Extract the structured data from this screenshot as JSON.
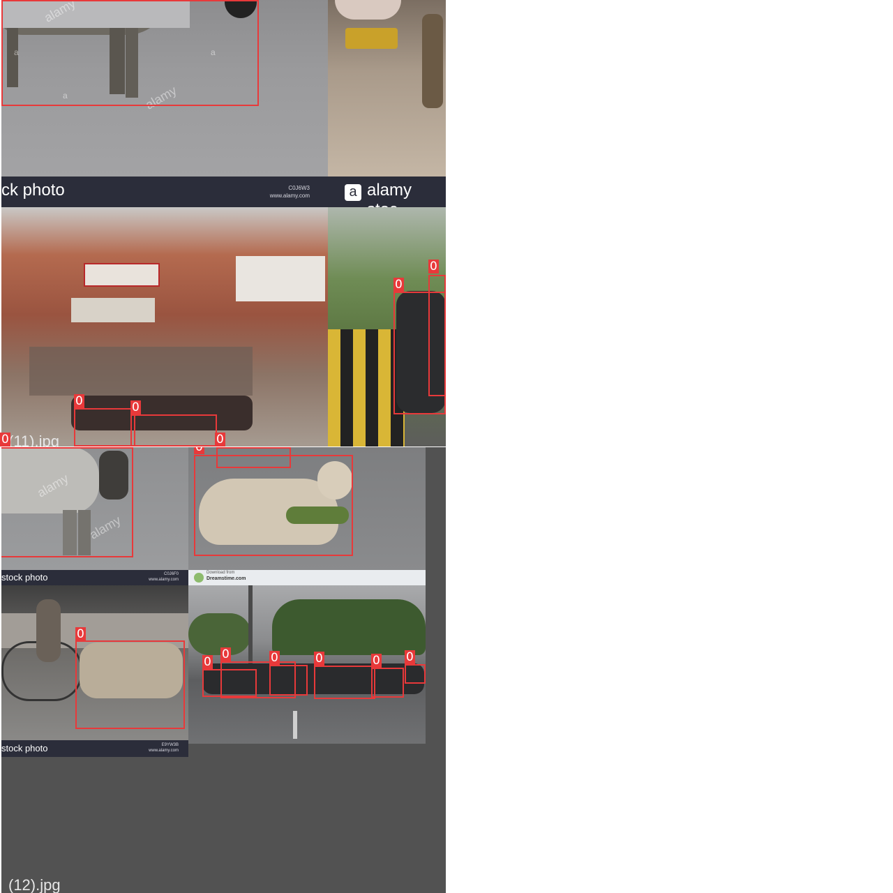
{
  "grid": {
    "tile_11": {
      "caption": "(11).jpg",
      "bar_text_left": "ck photo",
      "bar_code": "C0J6W3",
      "bar_url": "www.alamy.com",
      "bar_text_right": "alamy stoc",
      "watermark": "alamy",
      "detections": [
        {
          "label": "0"
        },
        {
          "label": "0"
        },
        {
          "label": "0"
        },
        {
          "label": "0"
        },
        {
          "label": "0"
        },
        {
          "label": "0"
        }
      ]
    },
    "tile_12": {
      "caption": "(12).jpg",
      "bar_text_1": "stock photo",
      "bar_code_1": "C0J6F0",
      "bar_url_1": "www.alamy.com",
      "bar_text_2": "stock photo",
      "bar_code_2": "E9YW3B",
      "bar_url_2": "www.alamy.com",
      "dreamstime_title": "Download from",
      "dreamstime_site": "Dreamstime.com",
      "detections": [
        {
          "label": "0"
        },
        {
          "label": "0"
        },
        {
          "label": "0"
        },
        {
          "label": "0"
        },
        {
          "label": "0"
        },
        {
          "label": "0"
        },
        {
          "label": "0"
        },
        {
          "label": "0"
        },
        {
          "label": "0"
        },
        {
          "label": "0"
        }
      ]
    }
  },
  "colors": {
    "box": "#e8393a",
    "bar": "#2b2d3a",
    "background": "#525252"
  }
}
